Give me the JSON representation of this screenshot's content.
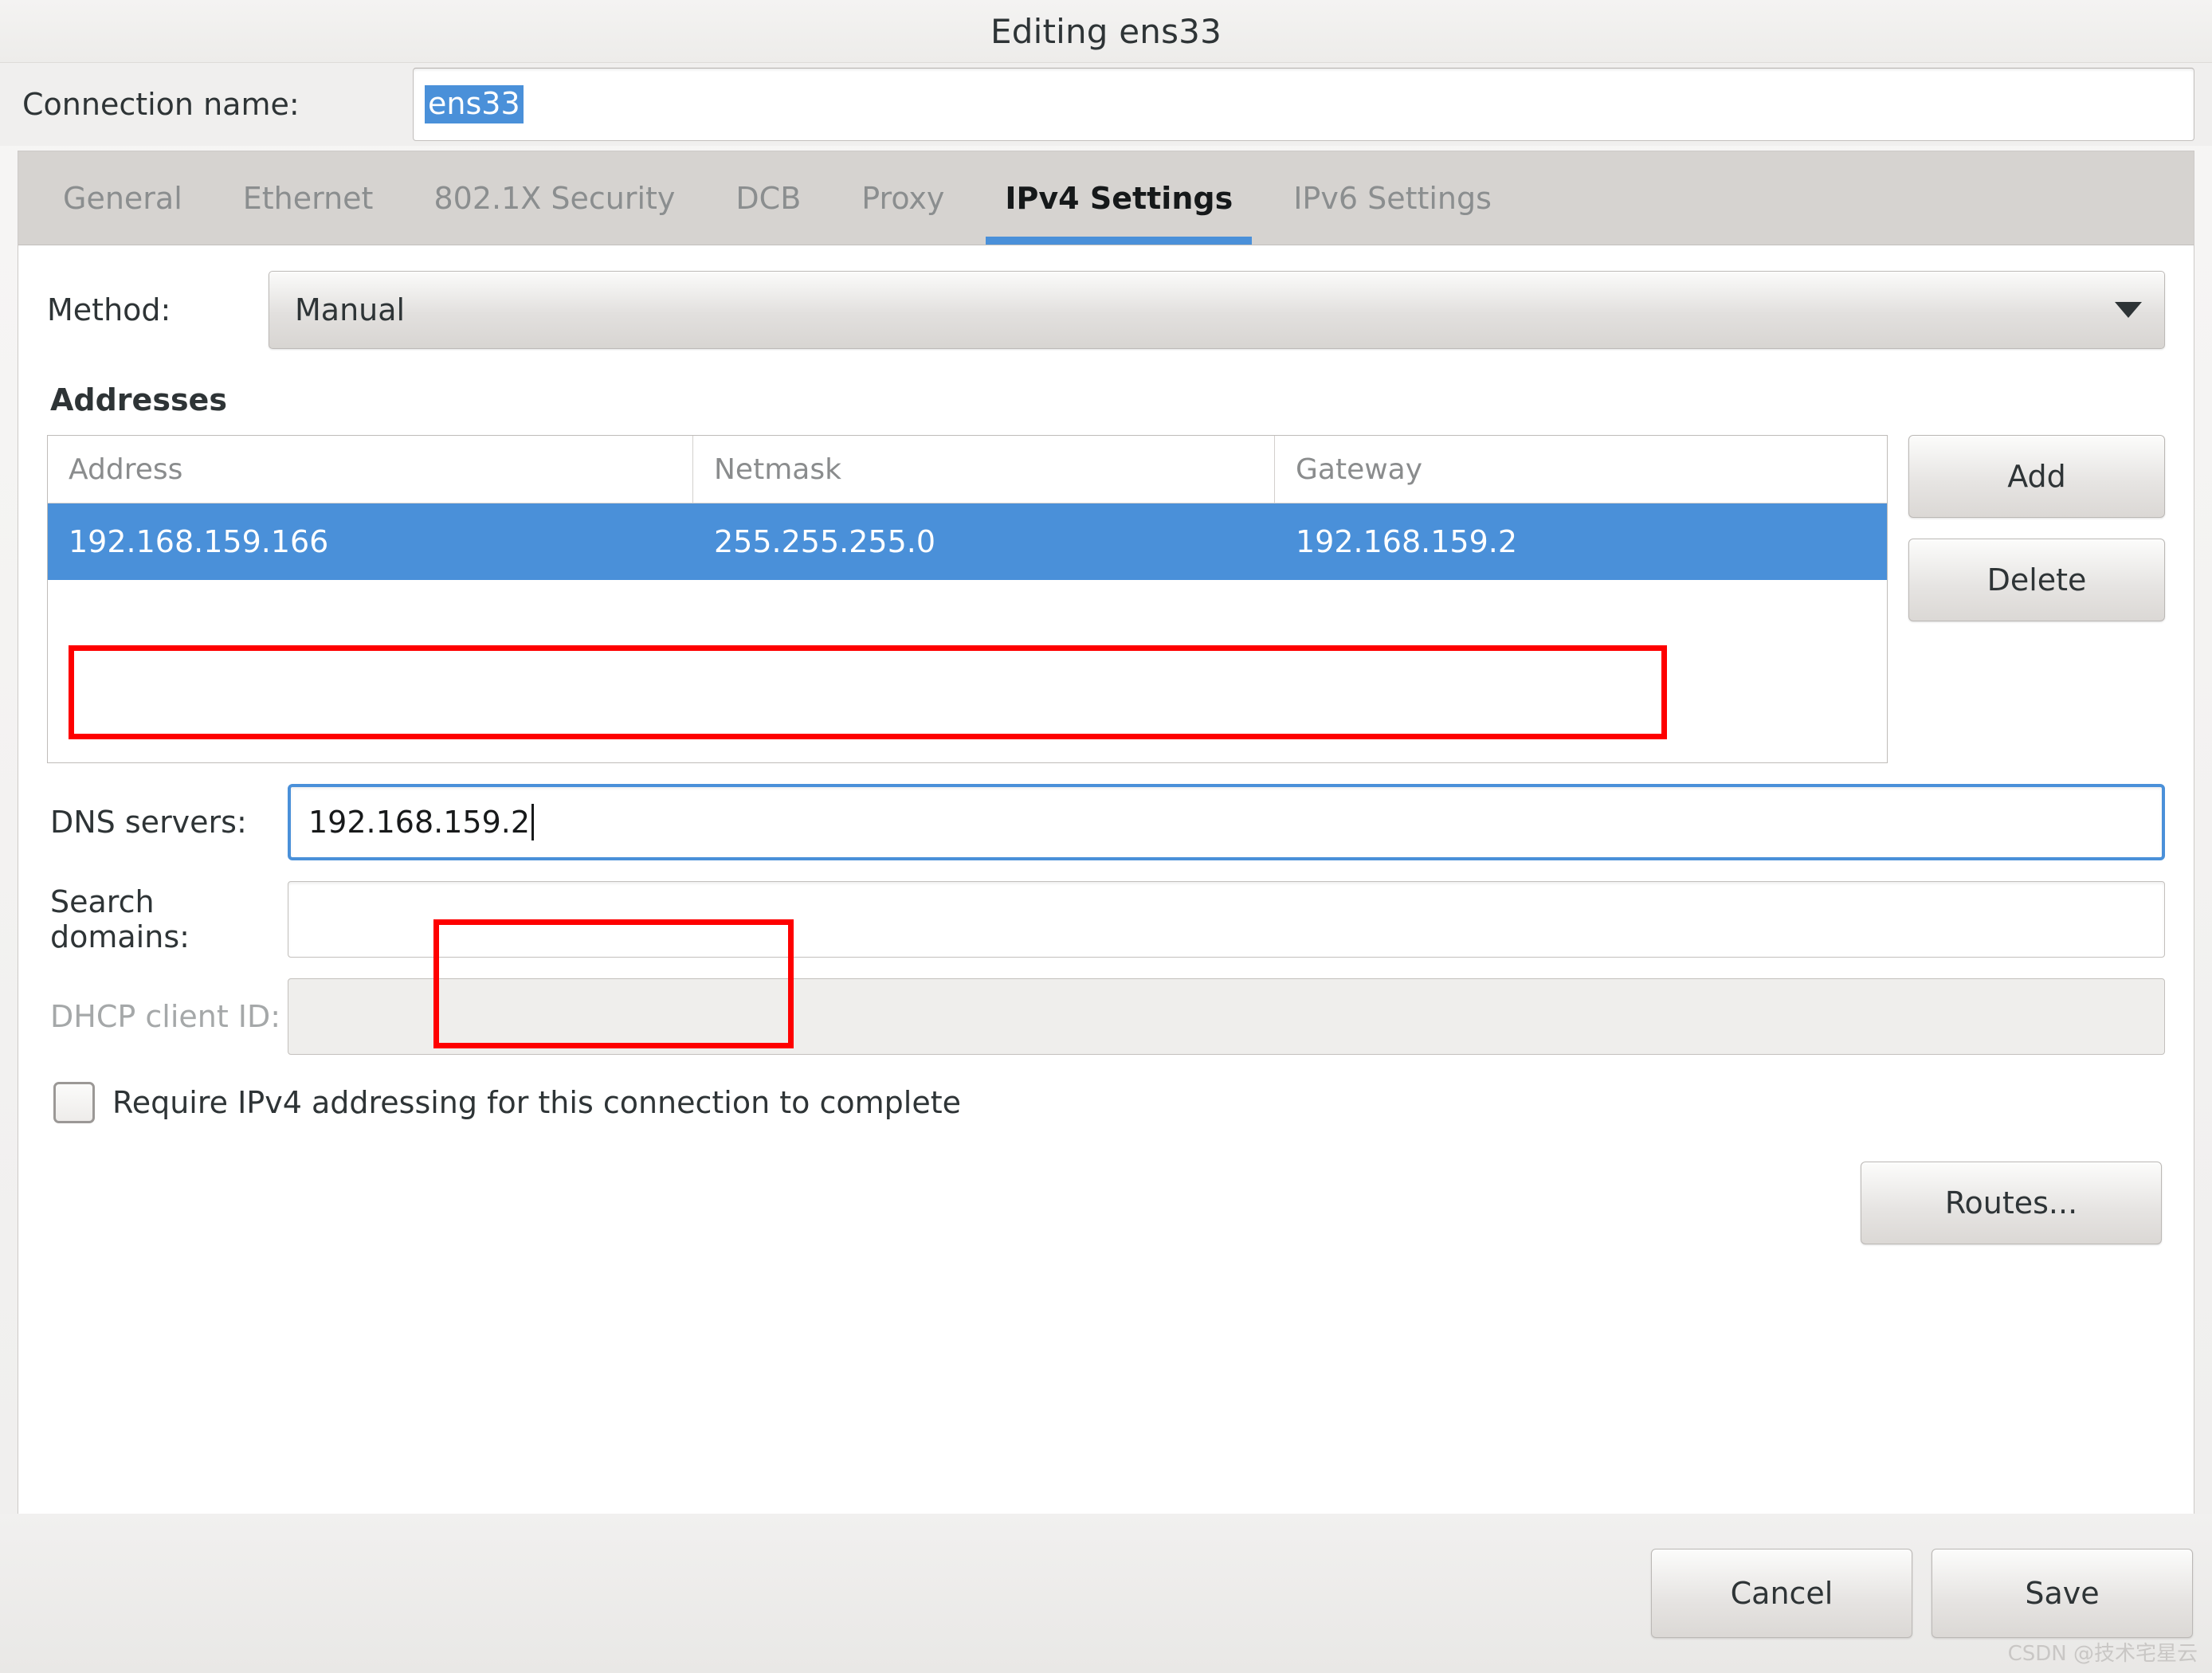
{
  "window": {
    "title": "Editing ens33"
  },
  "connection": {
    "label": "Connection name:",
    "value": "ens33"
  },
  "tabs": [
    {
      "label": "General",
      "active": false
    },
    {
      "label": "Ethernet",
      "active": false
    },
    {
      "label": "802.1X Security",
      "active": false
    },
    {
      "label": "DCB",
      "active": false
    },
    {
      "label": "Proxy",
      "active": false
    },
    {
      "label": "IPv4 Settings",
      "active": true
    },
    {
      "label": "IPv6 Settings",
      "active": false
    }
  ],
  "ipv4": {
    "method": {
      "label": "Method:",
      "value": "Manual"
    },
    "addresses": {
      "section_title": "Addresses",
      "columns": [
        "Address",
        "Netmask",
        "Gateway"
      ],
      "rows": [
        {
          "address": "192.168.159.166",
          "netmask": "255.255.255.0",
          "gateway": "192.168.159.2",
          "selected": true
        }
      ],
      "add_label": "Add",
      "delete_label": "Delete"
    },
    "dns_servers": {
      "label": "DNS servers:",
      "value": "192.168.159.2",
      "focused": true
    },
    "search_domains": {
      "label": "Search domains:",
      "value": ""
    },
    "dhcp_client_id": {
      "label": "DHCP client ID:",
      "value": "",
      "disabled": true
    },
    "require_ipv4": {
      "label": "Require IPv4 addressing for this connection to complete",
      "checked": false
    },
    "routes_label": "Routes..."
  },
  "actions": {
    "cancel_label": "Cancel",
    "save_label": "Save"
  },
  "watermark": "CSDN @技术宅星云",
  "colors": {
    "accent": "#4a90d9",
    "annotation": "#fe0000",
    "dialog_bg": "#f2f1f0",
    "tabbar_bg": "#d6d3d0",
    "text": "#2e3436",
    "muted_text": "#8b8e8f"
  }
}
